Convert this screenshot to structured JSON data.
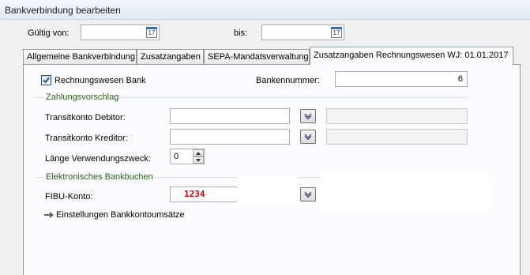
{
  "window": {
    "title": "Bankverbindung bearbeiten"
  },
  "validity": {
    "from_label": "Gültig von:",
    "from_value": "",
    "to_label": "bis:",
    "to_value": "",
    "calendar_glyph": "17"
  },
  "tabs": [
    {
      "label": "Allgemeine Bankverbindung",
      "active": false
    },
    {
      "label": "Zusatzangaben",
      "active": false
    },
    {
      "label": "SEPA-Mandatsverwaltung",
      "active": false
    },
    {
      "label": "Zusatzangaben Rechnungswesen WJ: 01.01.2017",
      "active": true
    }
  ],
  "form": {
    "rechnungswesen_label": "Rechnungswesen Bank",
    "rechnungswesen_checked": true,
    "bankennummer_label": "Bankennummer:",
    "bankennummer_value": "6",
    "zahlungsvorschlag_group": "Zahlungsvorschlag",
    "transit_debitor_label": "Transitkonto Debitor:",
    "transit_debitor_value": "",
    "transit_kreditor_label": "Transitkonto Kreditor:",
    "transit_kreditor_value": "",
    "laenge_label": "Länge Verwendungszweck:",
    "laenge_value": "0",
    "elektronisch_group": "Elektronisches Bankbuchen",
    "fibu_label": "FIBU-Konto:",
    "fibu_value": "1234",
    "einstellungen_link": "Einstellungen Bankkontoumsätze"
  },
  "colors": {
    "group_label": "#2b5e1e",
    "fibu_value": "#d00000",
    "checkbox_border": "#1c5180"
  },
  "icons": [
    "calendar-icon",
    "checkmark-icon",
    "chevron-down-icon",
    "spin-up-icon",
    "spin-down-icon",
    "arrow-right-icon"
  ]
}
